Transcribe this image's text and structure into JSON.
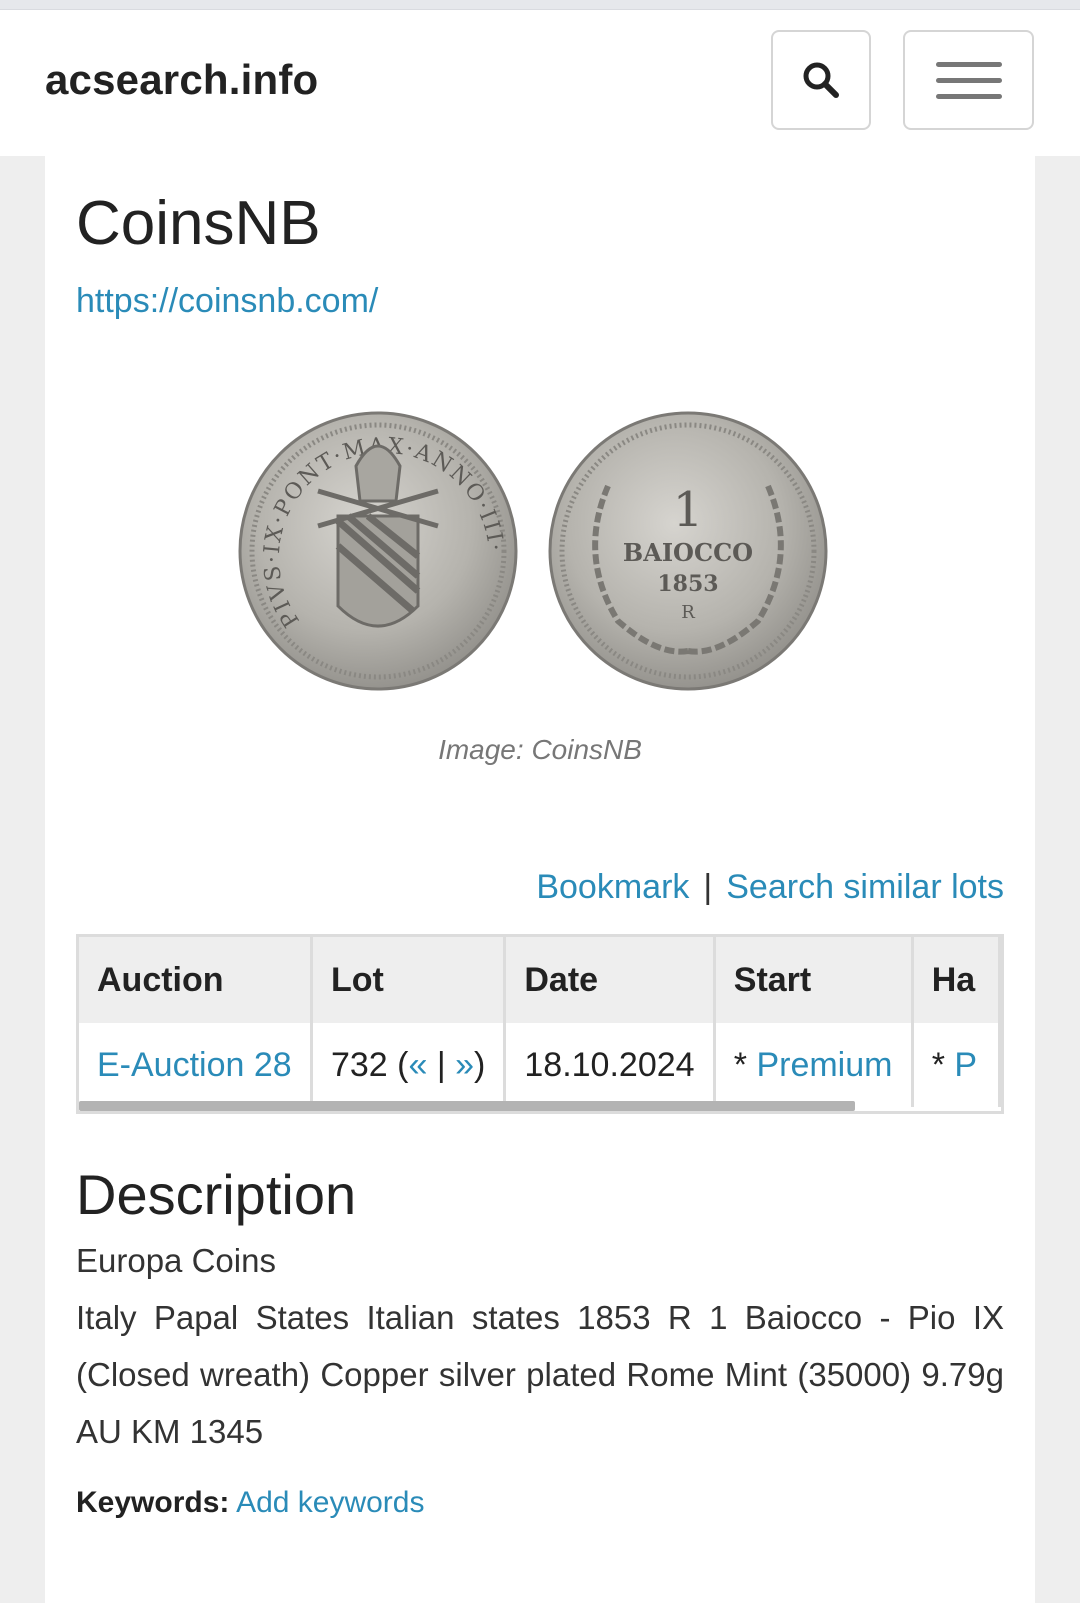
{
  "header": {
    "brand": "acsearch.info",
    "search_icon": "search-icon",
    "menu_icon": "hamburger-menu-icon"
  },
  "seller": {
    "name": "CoinsNB",
    "url": "https://coinsnb.com/"
  },
  "image": {
    "caption": "Image: CoinsNB",
    "obverse_legend": "PIVS·IX·PONT·MAX·ANNO·III·",
    "reverse_value": "1",
    "reverse_denomination": "BAIOCCO",
    "reverse_year": "1853",
    "reverse_mint": "R"
  },
  "actions": {
    "bookmark": "Bookmark",
    "separator": "|",
    "search_similar": "Search similar lots"
  },
  "lot_table": {
    "headers": [
      "Auction",
      "Lot",
      "Date",
      "Start",
      "Ha"
    ],
    "row": {
      "auction": "E-Auction 28",
      "lot_number": "732 (",
      "prev": "«",
      "pipe": " | ",
      "next": "»",
      "lot_close": ")",
      "date": "18.10.2024",
      "start_prefix": "* ",
      "start_link": "Premium",
      "hammer_prefix": "* ",
      "hammer_link": "P"
    }
  },
  "description": {
    "heading": "Description",
    "category": "Europa Coins",
    "text": "Italy Papal States Italian states 1853 R 1 Baiocco - Pio IX (Closed wreath) Copper silver plated Rome Mint (35000) 9.79g AU KM 1345"
  },
  "keywords": {
    "label": "Keywords:",
    "link": "Add keywords"
  },
  "colors": {
    "link": "#2a8bb8",
    "coin_silver": "#b5b3ad"
  }
}
